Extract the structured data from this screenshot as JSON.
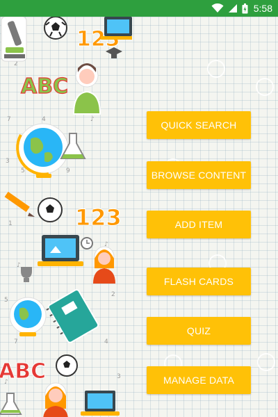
{
  "status_bar": {
    "time": "5:58",
    "bg_color": "#2e9f3e",
    "icons": [
      "wifi-icon",
      "cell-signal-icon",
      "battery-icon"
    ]
  },
  "illustration": {
    "labels": {
      "abc_top": "ABC",
      "num_top": "123",
      "num_mid": "123",
      "abc_bottom": "ABC"
    },
    "icons": [
      "microscope-icon",
      "soccer-ball-icon",
      "laptop-icon",
      "graduation-cap-icon",
      "student-boy-icon",
      "globe-icon",
      "pencil-icon",
      "student-girl-icon",
      "notebook-icon",
      "flask-icon",
      "trophy-icon",
      "clock-icon"
    ]
  },
  "menu": {
    "button_color": "#ffc107",
    "text_color": "#ffffff",
    "buttons": [
      {
        "label": "QUICK SEARCH"
      },
      {
        "label": "BROWSE CONTENT"
      },
      {
        "label": "ADD ITEM"
      },
      {
        "label": "FLASH CARDS"
      },
      {
        "label": "QUIZ"
      },
      {
        "label": "MANAGE DATA"
      }
    ]
  }
}
